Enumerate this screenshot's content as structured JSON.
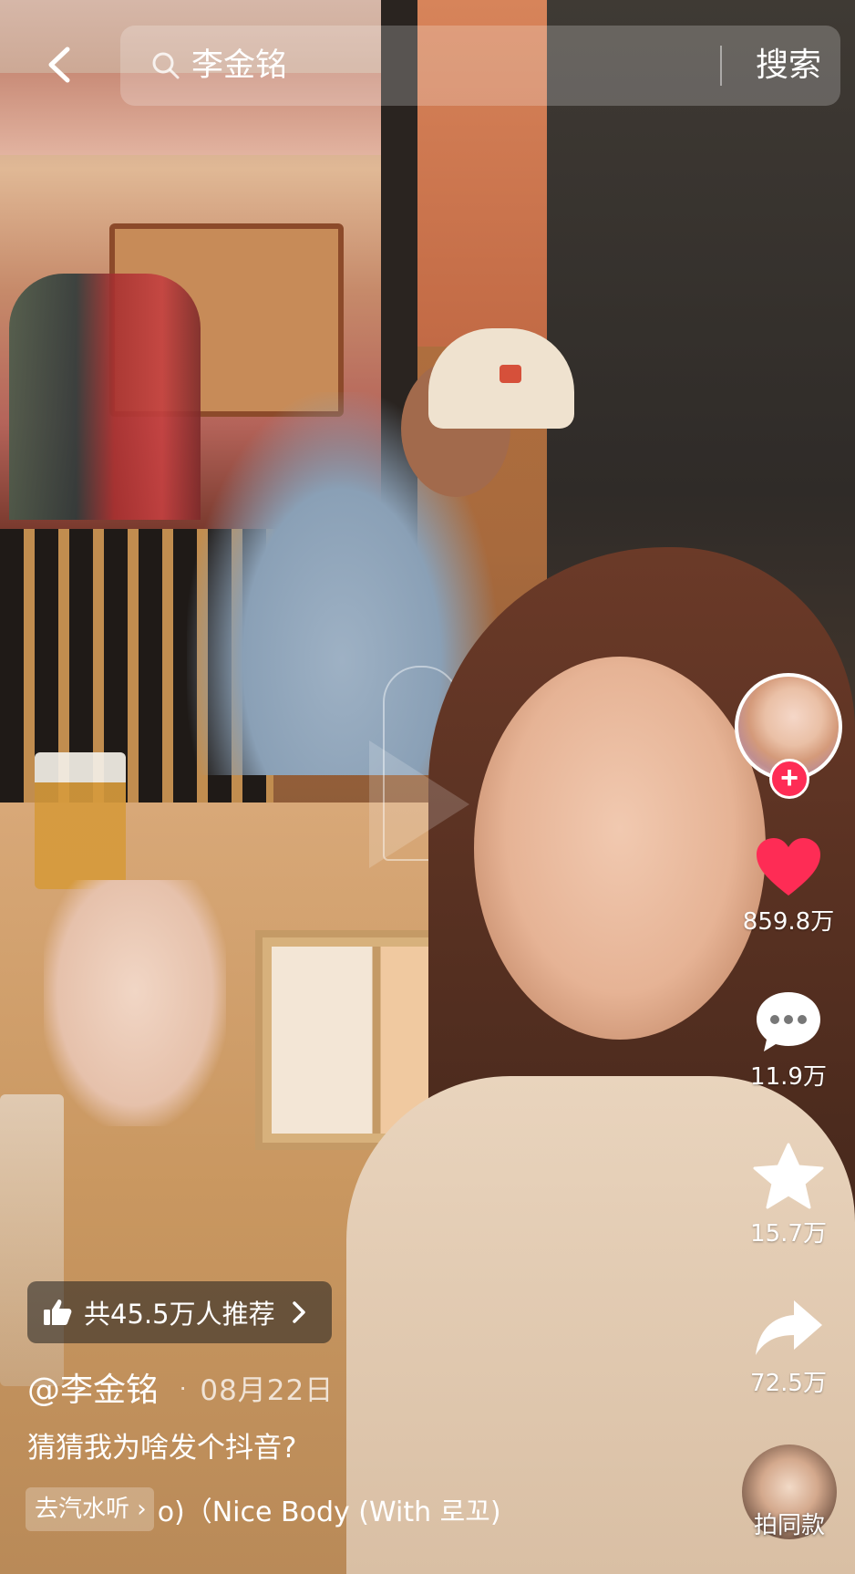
{
  "search": {
    "query": "李金铭",
    "button_label": "搜索"
  },
  "author": {
    "handle": "@李金铭",
    "date": "08月22日"
  },
  "caption": "猜猜我为啥发个抖音?",
  "recommend": {
    "label": "共45.5万人推荐"
  },
  "music": {
    "listen_label": "去汽水听",
    "title": "o)（Nice Body (With 로꼬)"
  },
  "actions": {
    "likes": "859.8万",
    "comments": "11.9万",
    "favorites": "15.7万",
    "shares": "72.5万",
    "same_style": "拍同款"
  },
  "colors": {
    "like_red": "#fe2c55",
    "follow_red": "#fe2c55"
  },
  "icons": [
    "back-arrow-icon",
    "search-icon",
    "plus-icon",
    "heart-icon",
    "comment-icon",
    "star-icon",
    "share-icon",
    "thumbs-up-icon",
    "chevron-right-icon"
  ]
}
